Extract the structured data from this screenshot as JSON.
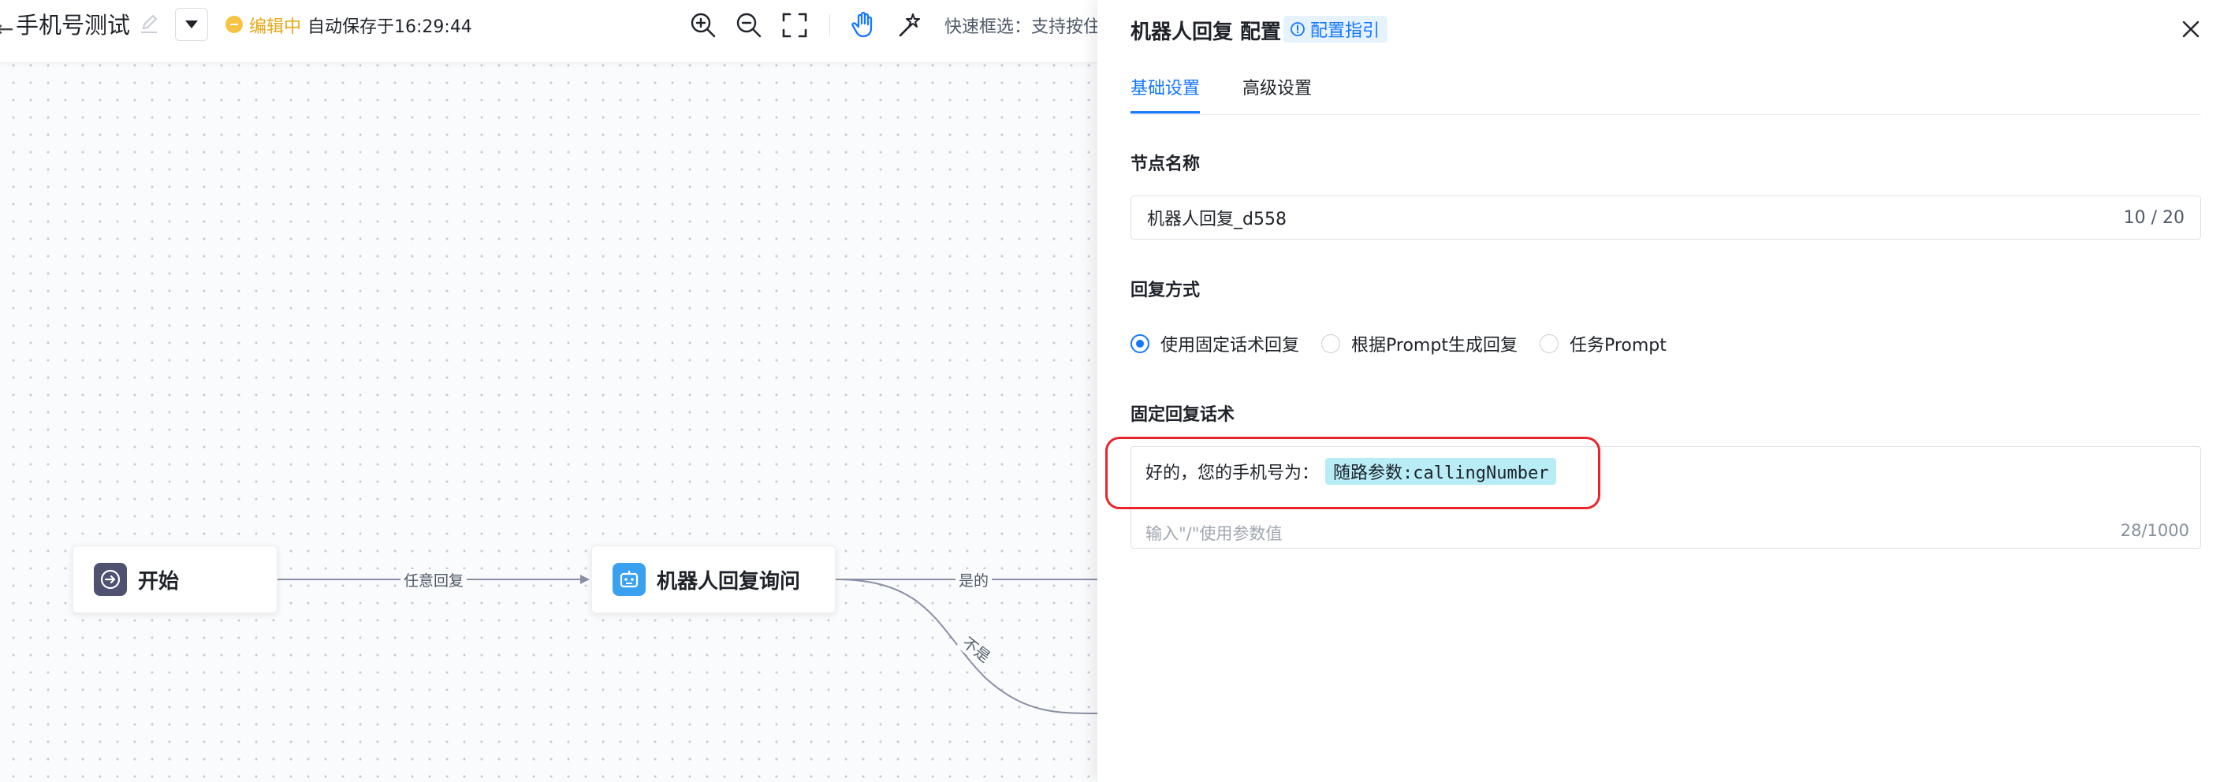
{
  "toolbar": {
    "back_glyph": "←",
    "title": "手机号测试",
    "status": "编辑中",
    "saved_text": "自动保存于16:29:44",
    "hint": "快速框选：支持按住"
  },
  "flow": {
    "nodes": [
      {
        "id": "start",
        "label": "开始"
      },
      {
        "id": "bot",
        "label": "机器人回复询问"
      }
    ],
    "edges": [
      {
        "label": "任意回复"
      },
      {
        "label": "是的"
      },
      {
        "label": "不是"
      }
    ]
  },
  "panel": {
    "title": "机器人回复 配置",
    "guide_label": "配置指引",
    "tabs": [
      {
        "label": "基础设置",
        "active": true
      },
      {
        "label": "高级设置",
        "active": false
      }
    ],
    "node_name": {
      "label": "节点名称",
      "value": "机器人回复_d558",
      "counter": "10 / 20"
    },
    "reply_mode": {
      "label": "回复方式",
      "options": [
        {
          "label": "使用固定话术回复",
          "checked": true
        },
        {
          "label": "根据Prompt生成回复",
          "checked": false
        },
        {
          "label": "任务Prompt",
          "checked": false
        }
      ]
    },
    "fixed_reply": {
      "label": "固定回复话术",
      "text": "好的，您的手机号为：",
      "param_tag": "随路参数:callingNumber",
      "placeholder": "输入\"/\"使用参数值",
      "counter": "28/1000"
    }
  },
  "colors": {
    "accent": "#1677ff",
    "status": "#e6a817",
    "highlight": "#e8262a",
    "param_tag_bg": "#b8ecf7"
  }
}
